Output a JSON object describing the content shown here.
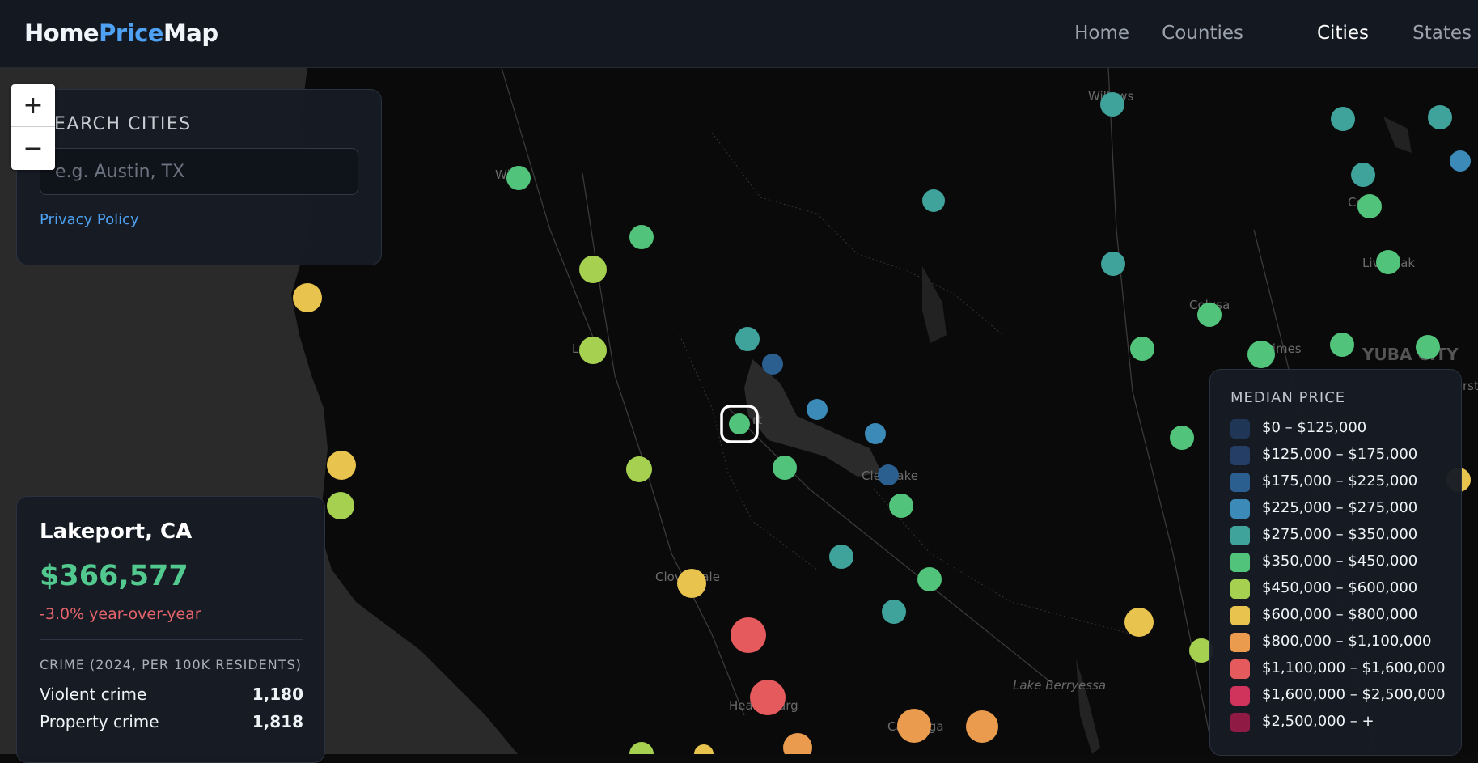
{
  "header": {
    "brand_part1": "Home",
    "brand_part2": "Price",
    "brand_part3": "Map",
    "brand_accent_color": "#4ea1f3",
    "nav": [
      "Home",
      "Counties",
      "Cities",
      "States"
    ],
    "active_nav": "Cities"
  },
  "search": {
    "title": "EARCH CITIES",
    "placeholder": "e.g. Austin, TX",
    "privacy_link": "Privacy Policy"
  },
  "zoom": {
    "in_label": "+",
    "out_label": "−"
  },
  "map": {
    "labels": [
      "Willows",
      "Wi",
      "Lu",
      "rt",
      "Clearlake",
      "Cloverdale",
      "Healdsburg",
      "Calistoga",
      "Lake Berryessa",
      "YUBA CITY",
      "Co",
      "Live Oak",
      "Colusa",
      "Grimes",
      "rst"
    ],
    "selected_city": "Lakeport, CA"
  },
  "city_info": {
    "name": "Lakeport, CA",
    "price": "$366,577",
    "yoy": "-3.0% year-over-year",
    "crime_title": "CRIME (2024, PER 100K RESIDENTS)",
    "rows": [
      {
        "label": "Violent crime",
        "value": "1,180"
      },
      {
        "label": "Property crime",
        "value": "1,818"
      }
    ]
  },
  "legend": {
    "title": "MEDIAN PRICE",
    "items": [
      {
        "label": "$0 – $125,000",
        "color": "#1f3657"
      },
      {
        "label": "$125,000 – $175,000",
        "color": "#243e66"
      },
      {
        "label": "$175,000 – $225,000",
        "color": "#2b5f8f"
      },
      {
        "label": "$225,000 – $275,000",
        "color": "#3b8ab8"
      },
      {
        "label": "$275,000 – $350,000",
        "color": "#3fa39b"
      },
      {
        "label": "$350,000 – $450,000",
        "color": "#52c37a"
      },
      {
        "label": "$450,000 – $600,000",
        "color": "#a6d04f"
      },
      {
        "label": "$600,000 – $800,000",
        "color": "#e8c34e"
      },
      {
        "label": "$800,000 – $1,100,000",
        "color": "#ea9b4d"
      },
      {
        "label": "$1,100,000 – $1,600,000",
        "color": "#e45a5d"
      },
      {
        "label": "$1,600,000 – $2,500,000",
        "color": "#d0345c"
      },
      {
        "label": "$2,500,000 – +",
        "color": "#8f1b45"
      }
    ]
  }
}
